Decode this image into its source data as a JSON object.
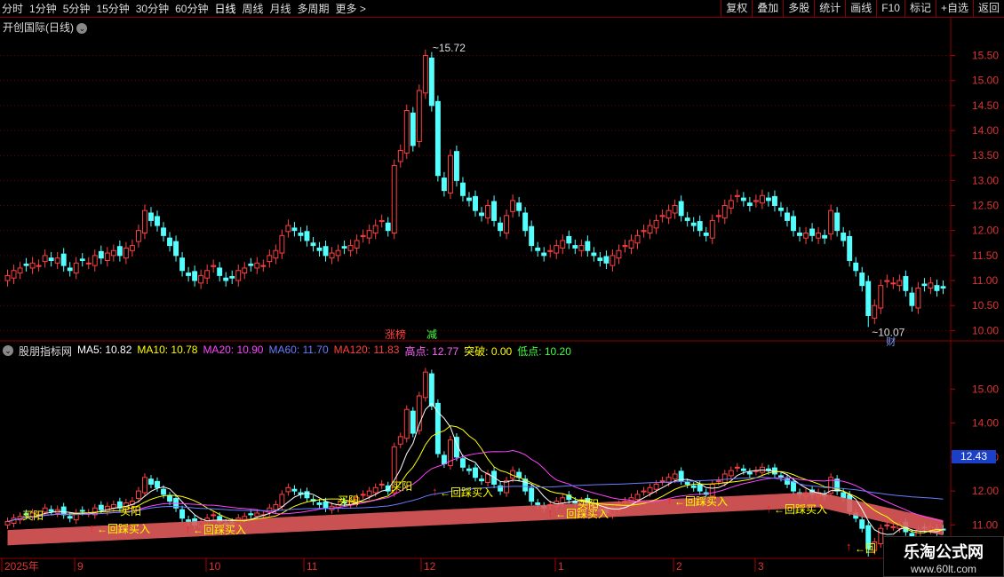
{
  "toolbar": {
    "periods": [
      "分时",
      "1分钟",
      "5分钟",
      "15分钟",
      "30分钟",
      "60分钟",
      "日线",
      "周线",
      "月线",
      "多周期",
      "更多 >"
    ],
    "active": "日线",
    "actions": [
      "复权",
      "叠加",
      "多股",
      "统计",
      "画线",
      "F10",
      "标记",
      "+自选",
      "返回"
    ]
  },
  "stock": {
    "title": "开创国际(日线)"
  },
  "price_axis": {
    "labels": [
      "15.50",
      "15.00",
      "14.50",
      "14.00",
      "13.50",
      "13.00",
      "12.50",
      "12.00",
      "11.50",
      "11.00",
      "10.50",
      "10.00"
    ]
  },
  "ind_axis": {
    "labels": [
      "15.00",
      "14.00",
      "13.00",
      "12.00",
      "11.00"
    ],
    "current": "12.43"
  },
  "annotations": {
    "high": "15.72",
    "low": "10.07",
    "tag1": "涨榜",
    "tag2": "减",
    "tag3": "财"
  },
  "indicator": {
    "name": "股朋指标网",
    "items": [
      {
        "label": "MA5: 10.82",
        "color": "#ffffff"
      },
      {
        "label": "MA10: 10.78",
        "color": "#ffff00"
      },
      {
        "label": "MA20: 10.90",
        "color": "#ff44ff"
      },
      {
        "label": "MA60: 11.70",
        "color": "#6b7cff"
      },
      {
        "label": "MA120: 11.83",
        "color": "#ff4040"
      },
      {
        "label": "高点: 12.77",
        "color": "#ff66ff"
      },
      {
        "label": "突破: 0.00",
        "color": "#ffff00"
      },
      {
        "label": "低点: 10.20",
        "color": "#44ff44"
      }
    ]
  },
  "signals": {
    "buy_yang": "买阳",
    "pullback": "←回踩买入",
    "pullback_short": "←回"
  },
  "time_axis": [
    "2025年",
    "9",
    "10",
    "11",
    "12",
    "1",
    "2",
    "3"
  ],
  "watermark": {
    "title": "乐淘公式网",
    "url": "www.60lt.com"
  },
  "chart_data": {
    "type": "candlestick",
    "title": "开创国际(日线)",
    "ylim_price": [
      9.9,
      15.9
    ],
    "high": 15.72,
    "low": 10.07,
    "close_series": [
      11.1,
      11.2,
      11.25,
      11.3,
      11.35,
      11.3,
      11.5,
      11.4,
      11.45,
      11.3,
      11.2,
      11.35,
      11.4,
      11.35,
      11.5,
      11.45,
      11.55,
      11.6,
      11.5,
      11.65,
      11.7,
      12.0,
      12.4,
      12.2,
      12.1,
      11.9,
      11.7,
      11.5,
      11.2,
      11.1,
      11.0,
      11.1,
      11.2,
      11.3,
      11.1,
      11.0,
      11.05,
      11.2,
      11.25,
      11.3,
      11.35,
      11.3,
      11.5,
      11.6,
      11.9,
      12.1,
      12.0,
      11.9,
      11.8,
      11.7,
      11.6,
      11.5,
      11.55,
      11.6,
      11.65,
      11.7,
      11.8,
      11.9,
      12.0,
      12.1,
      12.2,
      12.0,
      13.3,
      13.6,
      14.4,
      13.7,
      14.8,
      15.5,
      14.5,
      13.1,
      12.8,
      13.5,
      13.0,
      12.7,
      12.6,
      12.4,
      12.3,
      12.5,
      12.2,
      12.0,
      12.3,
      12.6,
      12.4,
      12.0,
      11.7,
      11.6,
      11.5,
      11.6,
      11.7,
      11.8,
      11.75,
      11.65,
      11.7,
      11.6,
      11.5,
      11.4,
      11.35,
      11.5,
      11.6,
      11.7,
      11.8,
      11.9,
      12.0,
      12.1,
      12.2,
      12.3,
      12.4,
      12.5,
      12.3,
      12.2,
      12.1,
      12.0,
      11.9,
      12.2,
      12.3,
      12.5,
      12.6,
      12.7,
      12.6,
      12.5,
      12.6,
      12.7,
      12.6,
      12.5,
      12.4,
      12.2,
      12.0,
      11.9,
      11.95,
      11.9,
      11.95,
      11.85,
      12.4,
      12.0,
      11.8,
      11.4,
      11.2,
      10.9,
      10.3,
      10.5,
      10.9,
      11.0,
      10.95,
      11.0,
      10.8,
      10.5,
      10.85,
      10.9,
      10.95,
      10.8,
      10.85
    ]
  }
}
